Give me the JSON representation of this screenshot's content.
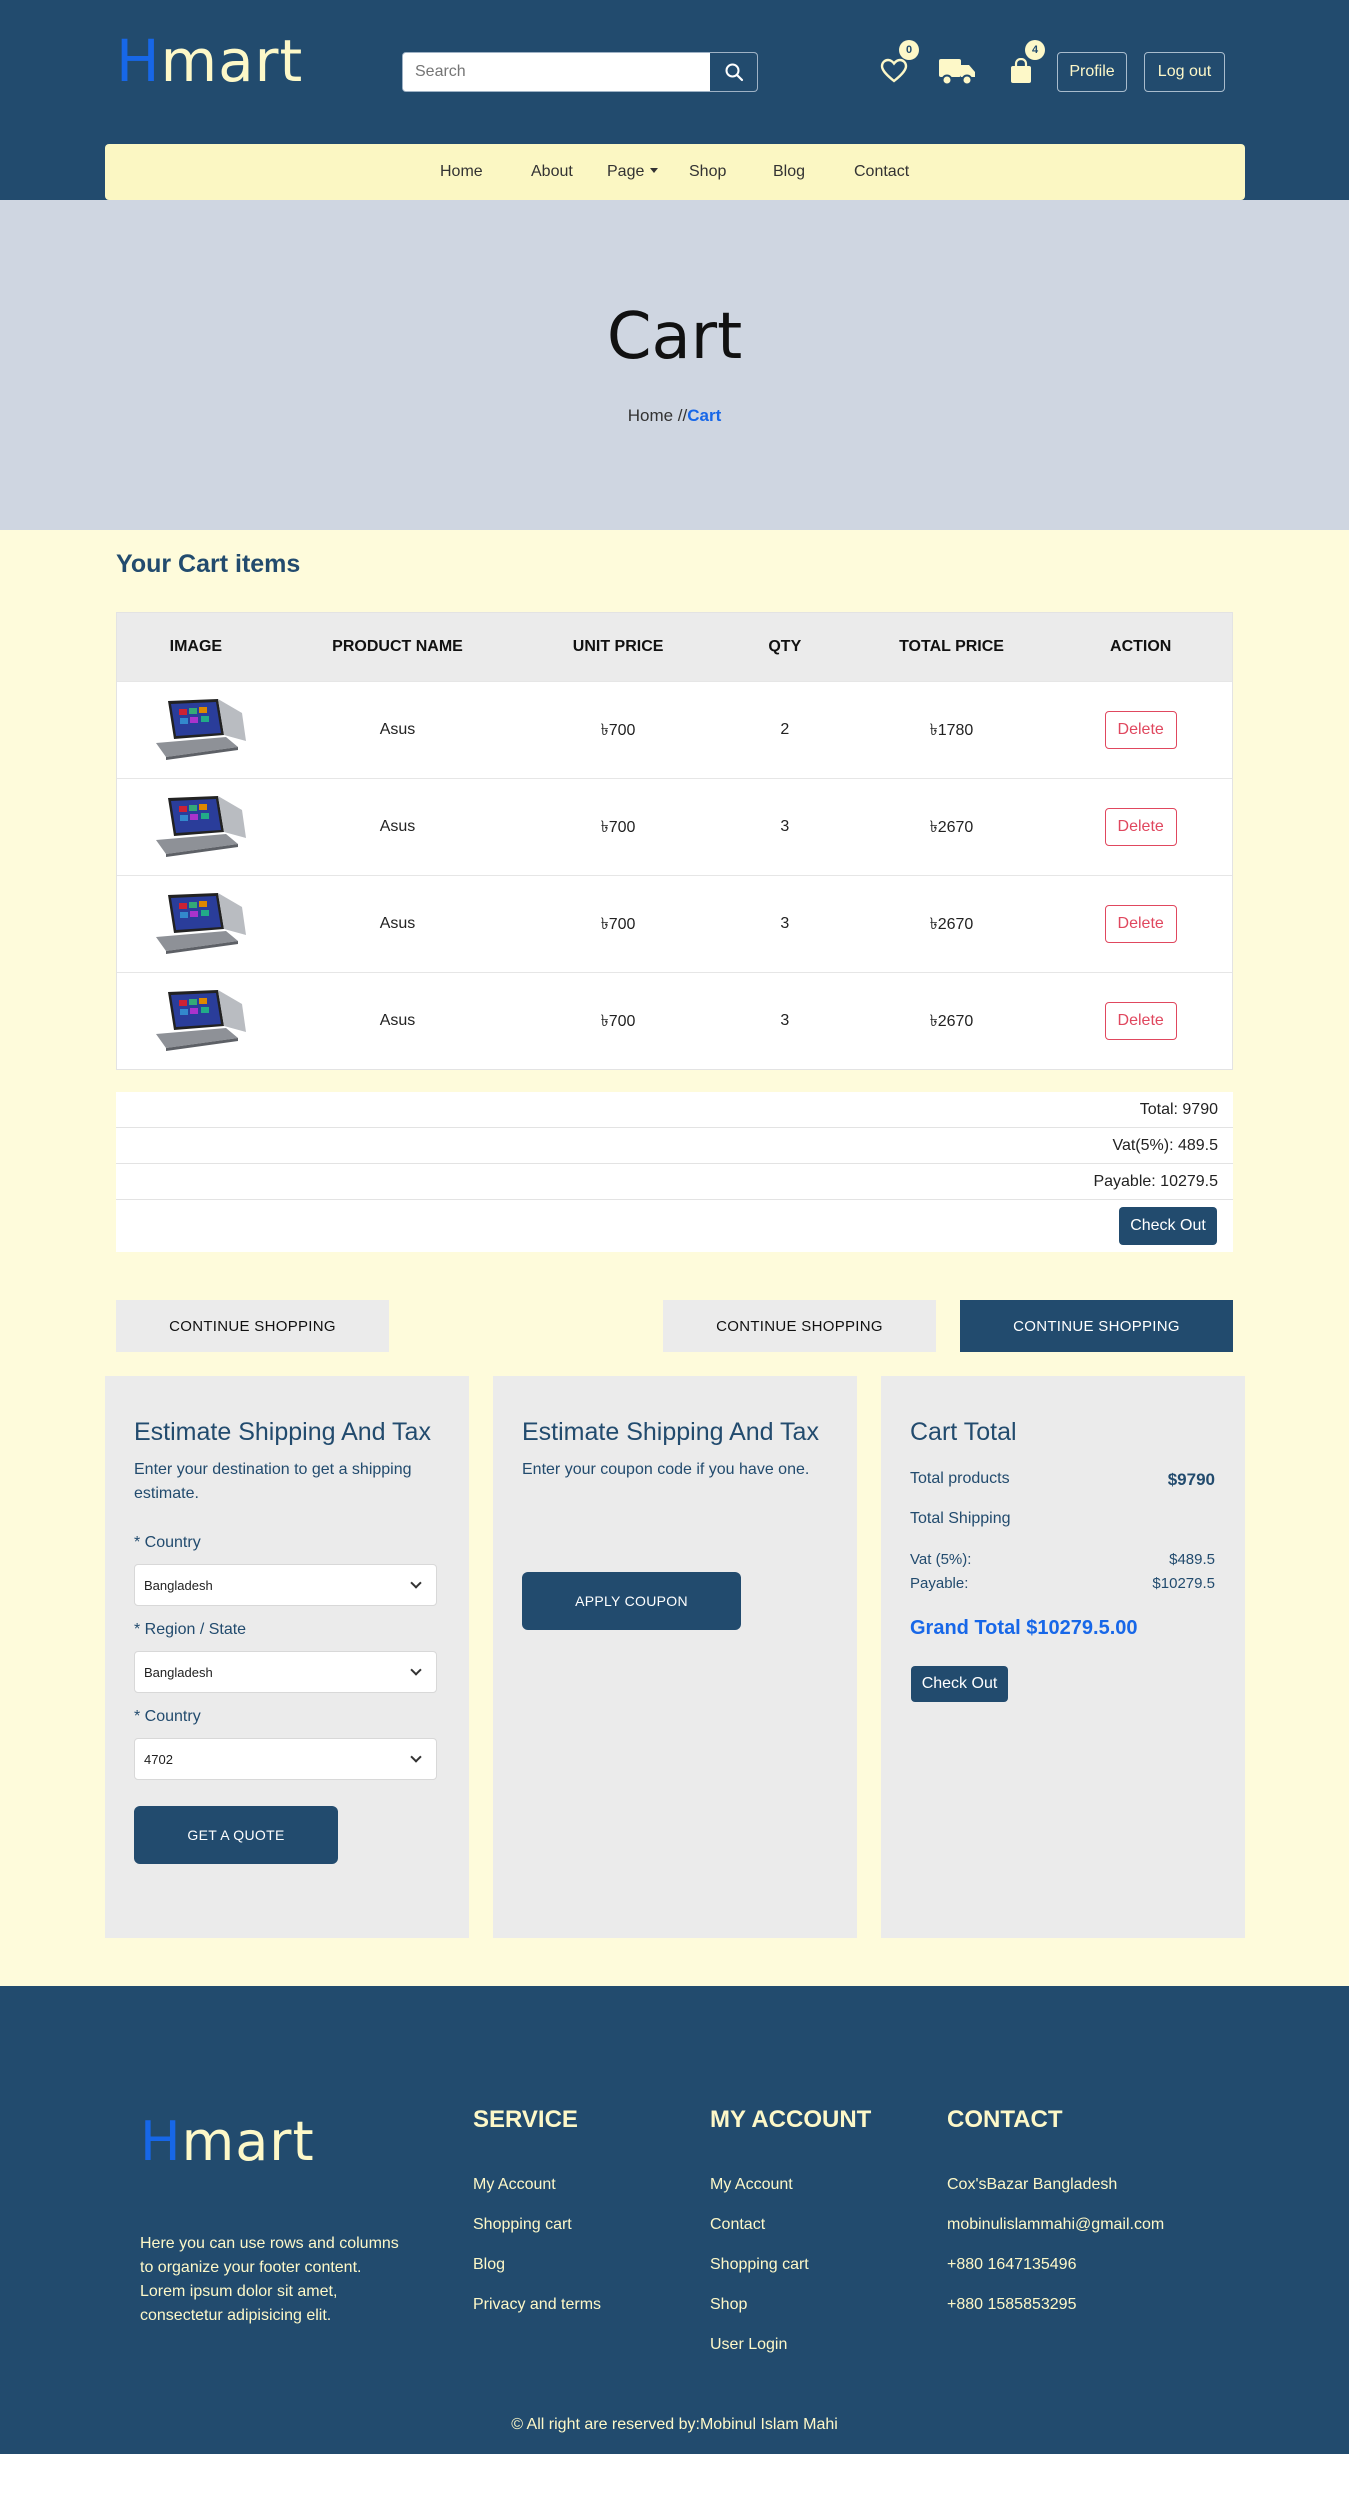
{
  "header": {
    "logo_first": "H",
    "logo_rest": "mart",
    "search_placeholder": "Search",
    "wishlist_count": "0",
    "cart_count": "4",
    "profile_label": "Profile",
    "logout_label": "Log out"
  },
  "nav": {
    "home": "Home",
    "about": "About",
    "page": "Page",
    "shop": "Shop",
    "blog": "Blog",
    "contact": "Contact"
  },
  "hero": {
    "title": "Cart",
    "crumb_home": "Home",
    "crumb_sep": " //",
    "crumb_current": "Cart"
  },
  "cart": {
    "title": "Your Cart items",
    "columns": [
      "IMAGE",
      "PRODUCT NAME",
      "UNIT PRICE",
      "QTY",
      "TOTAL PRICE",
      "ACTION"
    ],
    "rows": [
      {
        "name": "Asus",
        "unit_price": "৳700",
        "qty": "2",
        "total": "৳1780",
        "action": "Delete"
      },
      {
        "name": "Asus",
        "unit_price": "৳700",
        "qty": "3",
        "total": "৳2670",
        "action": "Delete"
      },
      {
        "name": "Asus",
        "unit_price": "৳700",
        "qty": "3",
        "total": "৳2670",
        "action": "Delete"
      },
      {
        "name": "Asus",
        "unit_price": "৳700",
        "qty": "3",
        "total": "৳2670",
        "action": "Delete"
      }
    ]
  },
  "summary": {
    "total": "Total: 9790",
    "vat": "Vat(5%): 489.5",
    "payable": "Payable: 10279.5",
    "checkout": "Check Out"
  },
  "continue": {
    "left": "CONTINUE SHOPPING",
    "middle": "CONTINUE SHOPPING",
    "right": "CONTINUE SHOPPING"
  },
  "shipping": {
    "title": "Estimate Shipping And Tax",
    "subtitle": "Enter your destination to get a shipping estimate.",
    "country_label": "* Country",
    "country_value": "Bangladesh",
    "region_label": "* Region / State",
    "region_value": "Bangladesh",
    "zip_label": "* Country",
    "zip_value": "4702",
    "quote_button": "GET A QUOTE"
  },
  "coupon": {
    "title": "Estimate Shipping And Tax",
    "subtitle": "Enter your coupon code if you have one.",
    "apply_button": "APPLY COUPON"
  },
  "cart_total": {
    "title": "Cart Total",
    "products_label": "Total products",
    "products_value": "$9790",
    "shipping_label": "Total Shipping",
    "vat_label": "Vat (5%):",
    "vat_value": "$489.5",
    "payable_label": "Payable:",
    "payable_value": "$10279.5",
    "grand_total": "Grand Total $10279.5.00",
    "checkout": "Check Out"
  },
  "footer": {
    "logo_first": "H",
    "logo_rest": "mart",
    "description": "Here you can use rows and columns to organize your footer content. Lorem ipsum dolor sit amet, consectetur adipisicing elit.",
    "service_title": "SERVICE",
    "service_links": [
      "My Account",
      "Shopping cart",
      "Blog",
      "Privacy and terms"
    ],
    "account_title": "MY ACCOUNT",
    "account_links": [
      "My Account",
      "Contact",
      "Shopping cart",
      "Shop",
      "User Login"
    ],
    "contact_title": "CONTACT",
    "contact_items": [
      "Cox'sBazar Bangladesh",
      "mobinulislammahi@gmail.com",
      "+880 1647135496",
      "+880 1585853295"
    ],
    "copyright": "© All right are reserved by:Mobinul Islam Mahi"
  }
}
